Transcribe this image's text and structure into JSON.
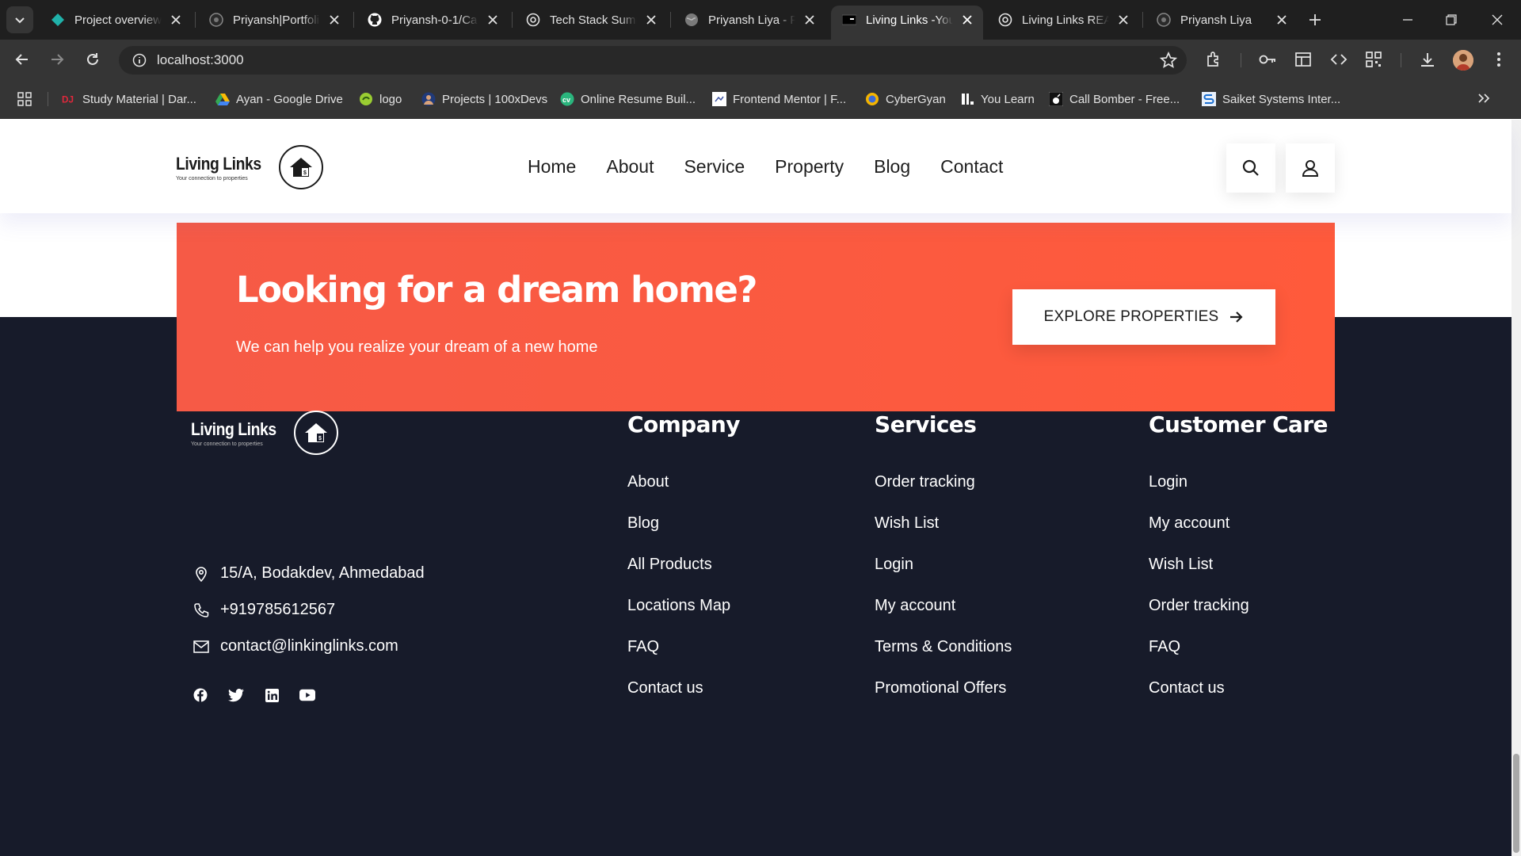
{
  "browser": {
    "tabs": [
      {
        "title": "Project overview",
        "favicon": "diamond-icon"
      },
      {
        "title": "Priyansh|Portfolio",
        "favicon": "globe-dark-icon"
      },
      {
        "title": "Priyansh-0-1/Cal",
        "favicon": "github-icon"
      },
      {
        "title": "Tech Stack Summ",
        "favicon": "openai-icon"
      },
      {
        "title": "Priyansh Liya - Fr",
        "favicon": "globe-icon"
      },
      {
        "title": "Living Links -You",
        "favicon": "app-icon",
        "active": true
      },
      {
        "title": "Living Links REAI",
        "favicon": "openai-icon"
      },
      {
        "title": "Priyansh Liya",
        "favicon": "globe-dark-icon"
      }
    ],
    "url": "localhost:3000",
    "bookmarks": [
      {
        "label": "Study Material | Dar...",
        "icon": "dj-icon"
      },
      {
        "label": "Ayan - Google Drive",
        "icon": "drive-icon"
      },
      {
        "label": "logo",
        "icon": "logo-icon"
      },
      {
        "label": "Projects | 100xDevs",
        "icon": "avatar-icon"
      },
      {
        "label": "Online Resume Buil...",
        "icon": "cv-icon"
      },
      {
        "label": "Frontend Mentor | F...",
        "icon": "fm-icon"
      },
      {
        "label": "CyberGyan",
        "icon": "cybergyan-icon"
      },
      {
        "label": "You Learn",
        "icon": "youlearn-icon"
      },
      {
        "label": "Call Bomber - Free...",
        "icon": "bomb-icon"
      },
      {
        "label": "Saiket Systems Inter...",
        "icon": "saiket-icon"
      }
    ]
  },
  "header": {
    "logo_word": "Living Links",
    "logo_tagline": "Your connection to properties",
    "nav": [
      "Home",
      "About",
      "Service",
      "Property",
      "Blog",
      "Contact"
    ]
  },
  "cta": {
    "title": "Looking for a dream home?",
    "subtitle": "We can help you realize your dream of a new home",
    "button": "EXPLORE PROPERTIES"
  },
  "footer": {
    "address": "15/A, Bodakdev, Ahmedabad",
    "phone": "+919785612567",
    "email": "contact@linkinglinks.com",
    "columns": [
      {
        "title": "Company",
        "links": [
          "About",
          "Blog",
          "All Products",
          "Locations Map",
          "FAQ",
          "Contact us"
        ]
      },
      {
        "title": "Services",
        "links": [
          "Order tracking",
          "Wish List",
          "Login",
          "My account",
          "Terms & Conditions",
          "Promotional Offers"
        ]
      },
      {
        "title": "Customer Care",
        "links": [
          "Login",
          "My account",
          "Wish List",
          "Order tracking",
          "FAQ",
          "Contact us"
        ]
      }
    ]
  },
  "colors": {
    "accent": "#ff5a3b",
    "footer_bg": "#171b2a"
  }
}
